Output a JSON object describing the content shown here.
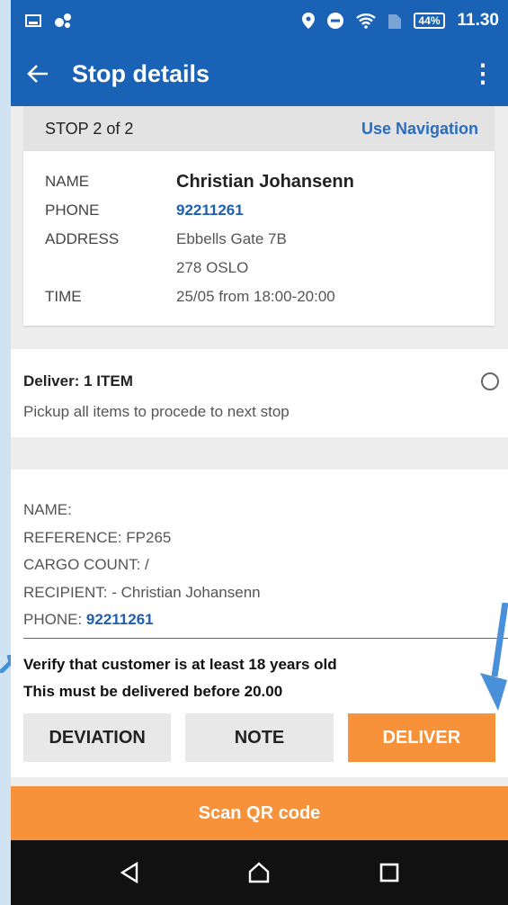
{
  "status_bar": {
    "battery": "44%",
    "time": "11.30"
  },
  "app_bar": {
    "title": "Stop details"
  },
  "stop": {
    "count": "STOP 2 of 2",
    "navigation_link": "Use Navigation",
    "fields": [
      {
        "label": "NAME",
        "value": "Christian Johansenn"
      },
      {
        "label": "PHONE",
        "value": "92211261"
      },
      {
        "label": "ADDRESS",
        "value": "Ebbells Gate 7B"
      },
      {
        "label": "",
        "value": "278 OSLO"
      },
      {
        "label": "TIME",
        "value": "25/05 from 18:00-20:00"
      }
    ]
  },
  "deliver": {
    "title": "Deliver: 1 ITEM",
    "subtitle": "Pickup all items to procede to next stop"
  },
  "item": {
    "name": "NAME:",
    "reference": "REFERENCE: FP265",
    "cargo_count": "CARGO COUNT: /",
    "recipient": "RECIPIENT: - Christian Johansenn",
    "phone_label": "PHONE: ",
    "phone_value": "92211261",
    "warning_age": "Verify that customer is at least 18 years old",
    "warning_time": "This must be delivered before 20.00"
  },
  "actions": {
    "deviation": "DEVIATION",
    "note": "NOTE",
    "deliver": "DELIVER"
  },
  "scan": {
    "label": "Scan QR code"
  },
  "colors": {
    "primary": "#1a62b5",
    "accent": "#f7923a",
    "link": "#1f5fb0"
  }
}
